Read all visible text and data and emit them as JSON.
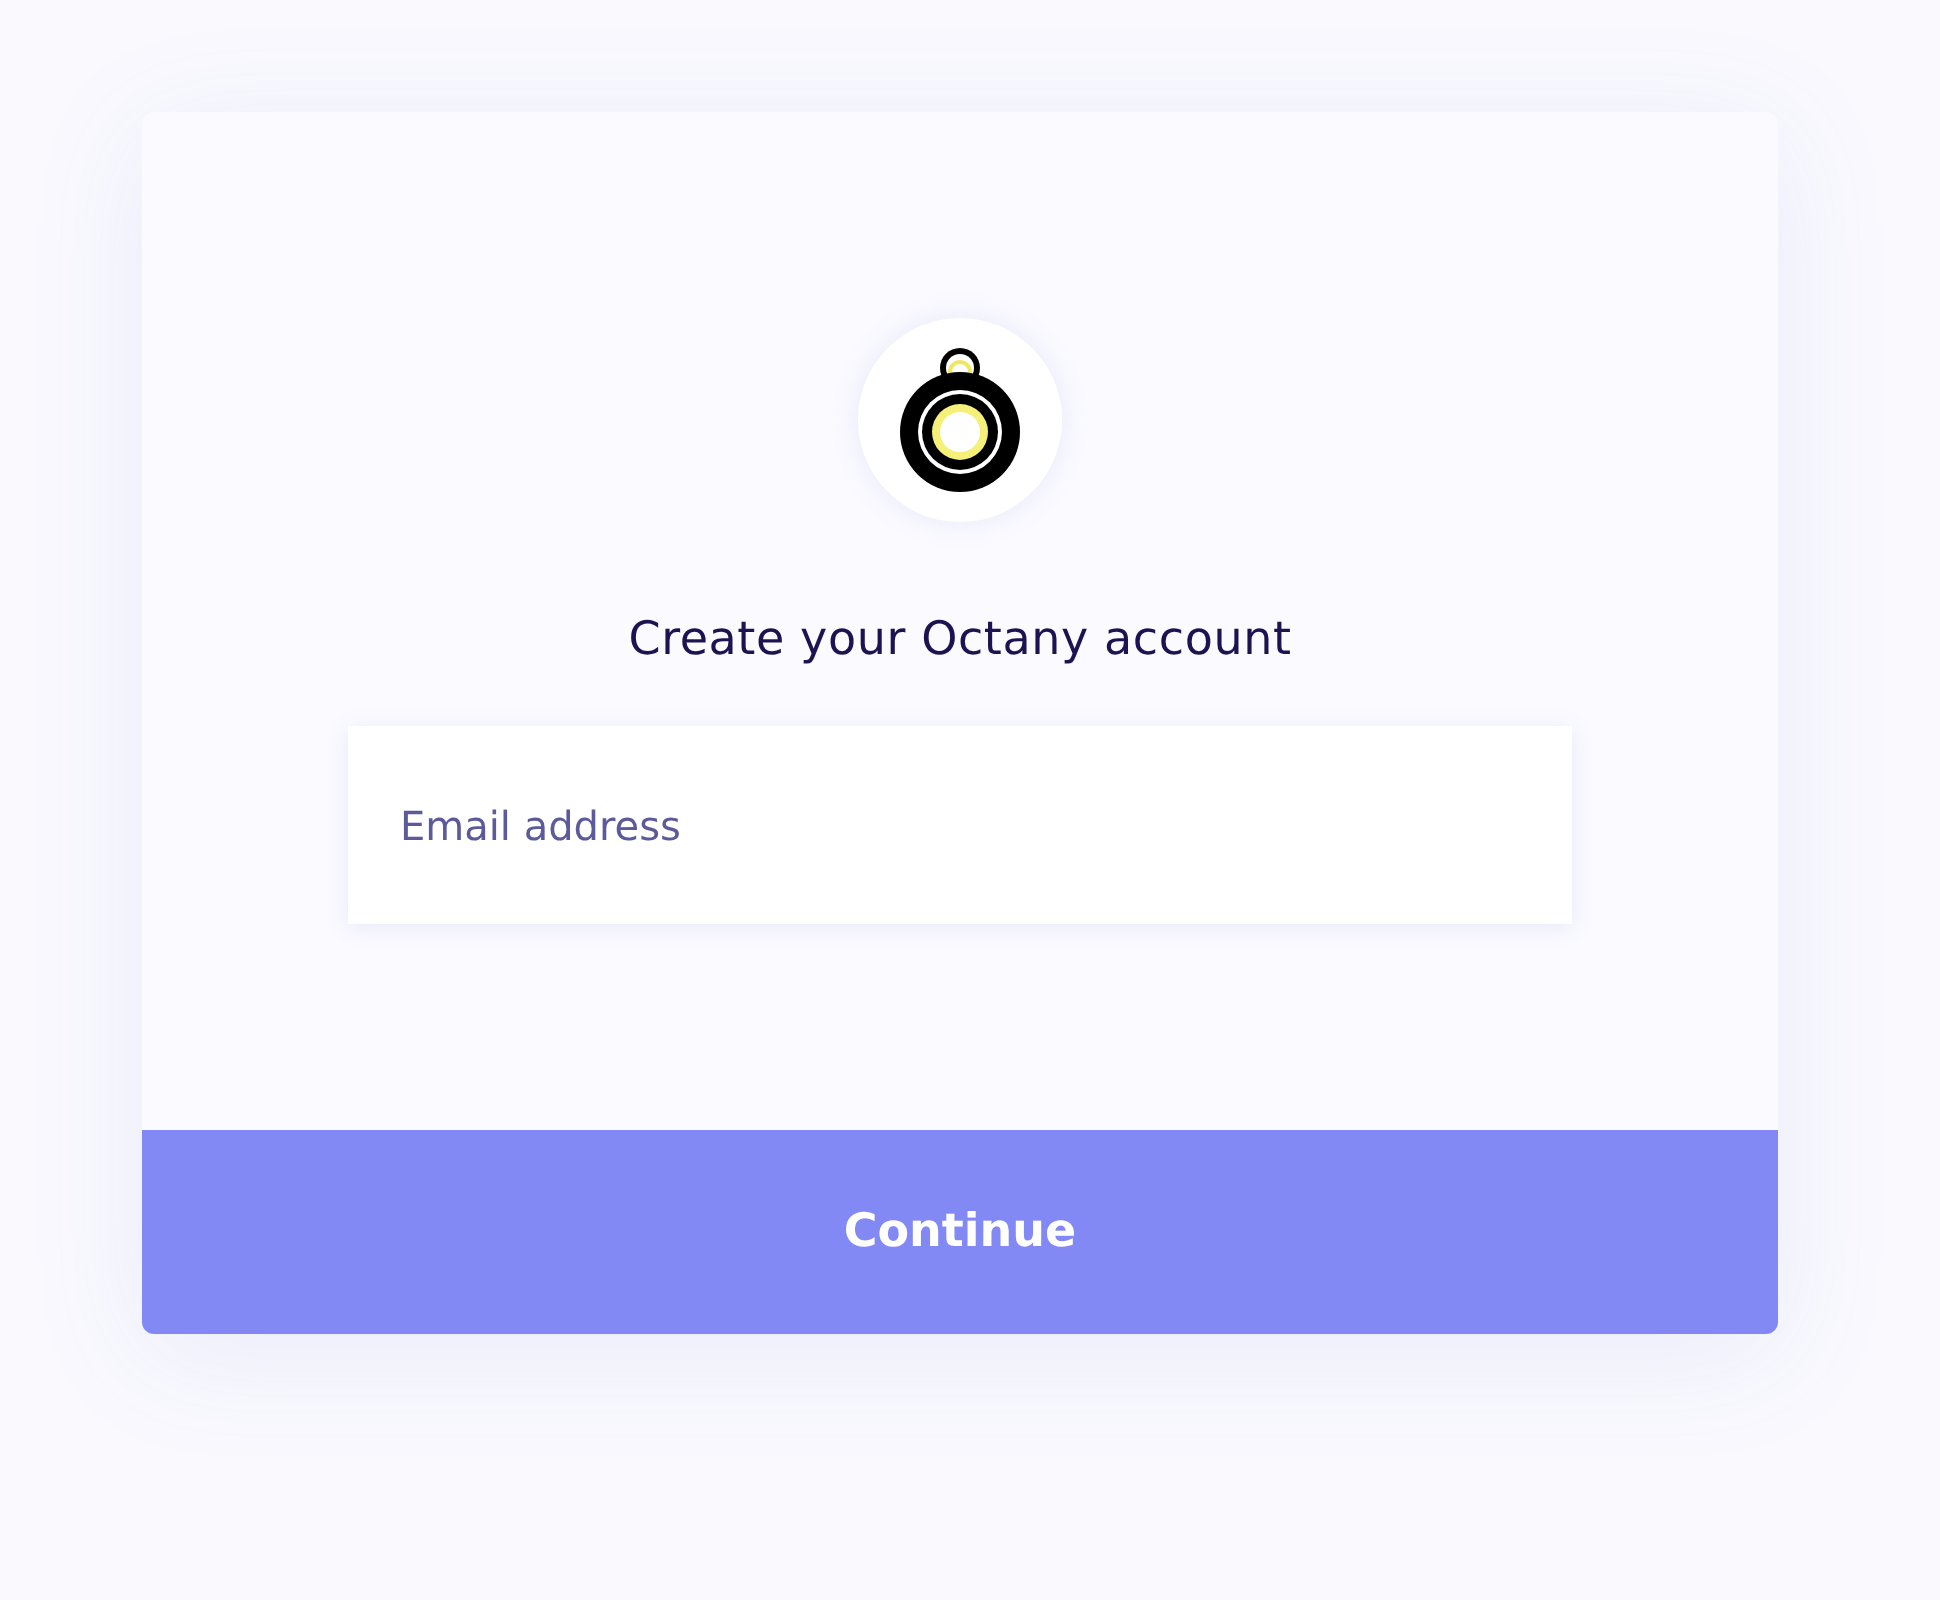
{
  "heading": "Create your Octany account",
  "email_field": {
    "placeholder": "Email address"
  },
  "continue_button": {
    "label": "Continue"
  }
}
